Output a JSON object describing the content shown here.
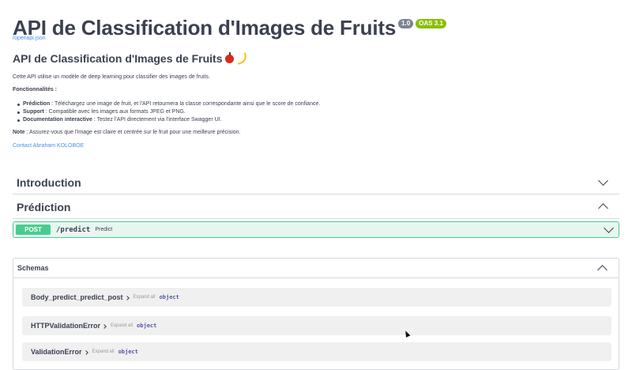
{
  "header": {
    "title": "API de Classification d'Images de Fruits",
    "version_badge": "1.0",
    "oas_badge": "OAS 3.1",
    "openapi_link": "/openapi.json"
  },
  "description": {
    "title": "API de Classification d'Images de Fruits",
    "intro": "Cette API utilise un modèle de deep learning pour classifier des images de fruits.",
    "features_heading": "Fonctionnalités :",
    "features": [
      {
        "label": "Prédiction",
        "text": " : Téléchargez une image de fruit, et l'API retournera la classe correspondante ainsi que le score de confiance."
      },
      {
        "label": "Support",
        "text": " : Compatible avec les images aux formats JPEG et PNG."
      },
      {
        "label": "Documentation interactive",
        "text": " : Testez l'API directement via l'interface Swagger UI."
      }
    ],
    "note_label": "Note",
    "note_text": " : Assurez-vous que l'image est claire et centrée sur le fruit pour une meilleure précision.",
    "contact": "Contact Abraham KOLOBOE"
  },
  "sections": {
    "introduction": "Introduction",
    "prediction": "Prédiction"
  },
  "operation": {
    "method": "POST",
    "path": "/predict",
    "summary": "Predict",
    "color": "#49cc90"
  },
  "schemas": {
    "title": "Schemas",
    "expand_label": "Expand all",
    "models": [
      {
        "name": "Body_predict_predict_post",
        "type": "object"
      },
      {
        "name": "HTTPValidationError",
        "type": "object"
      },
      {
        "name": "ValidationError",
        "type": "object"
      }
    ]
  }
}
